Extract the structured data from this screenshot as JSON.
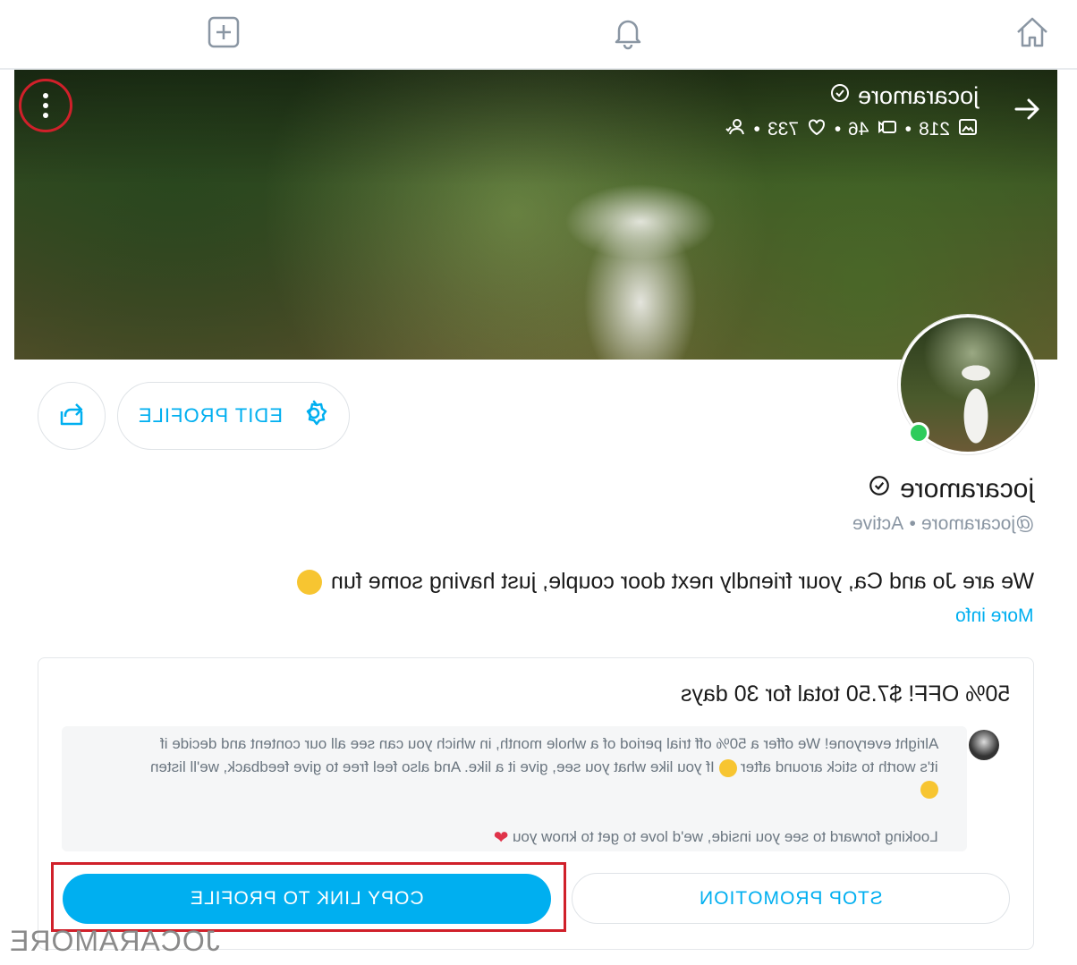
{
  "nav": {
    "icons": [
      "add-square-icon",
      "bell-icon",
      "home-icon"
    ]
  },
  "cover": {
    "username": "jocaramore",
    "stats": {
      "photos": "218",
      "videos": "46",
      "likes": "733"
    },
    "separator": "•"
  },
  "profile": {
    "edit_label": "EDIT PROFILE",
    "name": "jocaramore",
    "handle": "@jocaramore",
    "status": "Active",
    "bio": "We are Jo and Ca, your friendly next door couple, just having some fun",
    "more_info": "More info"
  },
  "promo": {
    "title": "50% OFF! $7.50 total for 30 days",
    "message_line1": "Alright everyone! We offer a 50% off trial period of a whole month, in which you can see all our content and decide if",
    "message_line2": "it's worth to stick around after",
    "message_line2b": "If you like what you see, give it a like. And also feel free to give feedback, we'll listen",
    "message_line3": "Looking forward to see you inside, we'd love to get to know you",
    "stop_label": "STOP PROMOTION",
    "copy_label": "COPY LINK TO PROFILE"
  },
  "watermark": "JOCARAMORE",
  "colors": {
    "accent": "#00aff0",
    "highlight": "#d0202a",
    "online": "#2ecc5c"
  }
}
